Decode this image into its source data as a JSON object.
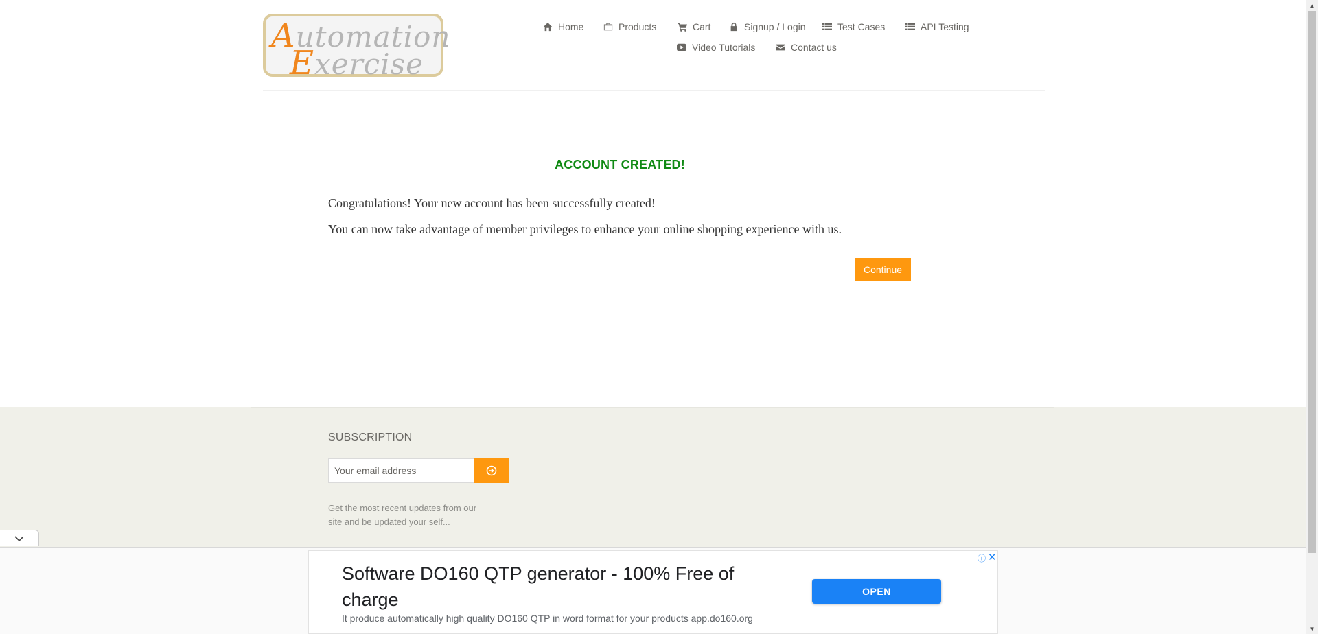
{
  "logo": {
    "line1_cap": "A",
    "line1_rest": "utomation",
    "line2_cap": "E",
    "line2_rest": "xercise"
  },
  "nav": {
    "items": [
      {
        "label": "Home",
        "icon": "home-icon"
      },
      {
        "label": "Products",
        "icon": "briefcase-icon"
      },
      {
        "label": "Cart",
        "icon": "cart-icon"
      },
      {
        "label": "Signup / Login",
        "icon": "lock-icon"
      },
      {
        "label": "Test Cases",
        "icon": "list-icon"
      },
      {
        "label": "API Testing",
        "icon": "list-icon"
      },
      {
        "label": "Video Tutorials",
        "icon": "youtube-icon"
      },
      {
        "label": "Contact us",
        "icon": "envelope-icon"
      }
    ]
  },
  "main": {
    "title": "ACCOUNT CREATED!",
    "message1": "Congratulations! Your new account has been successfully created!",
    "message2": "You can now take advantage of member privileges to enhance your online shopping experience with us.",
    "continue_label": "Continue"
  },
  "footer": {
    "subscription_title": "SUBSCRIPTION",
    "email_placeholder": "Your email address",
    "description": "Get the most recent updates from our site and be updated your self..."
  },
  "ad": {
    "title": "Software DO160 QTP generator - 100% Free of charge",
    "description": "It produce automatically high quality DO160 QTP in word format for your products app.do160.org",
    "open_label": "OPEN",
    "info_glyph": "ⓘ",
    "close_glyph": "✕"
  },
  "colors": {
    "accent": "#fe980f",
    "title_green": "#108a14",
    "footer_bg": "#f0f0e9",
    "ad_button": "#1a82f6"
  }
}
